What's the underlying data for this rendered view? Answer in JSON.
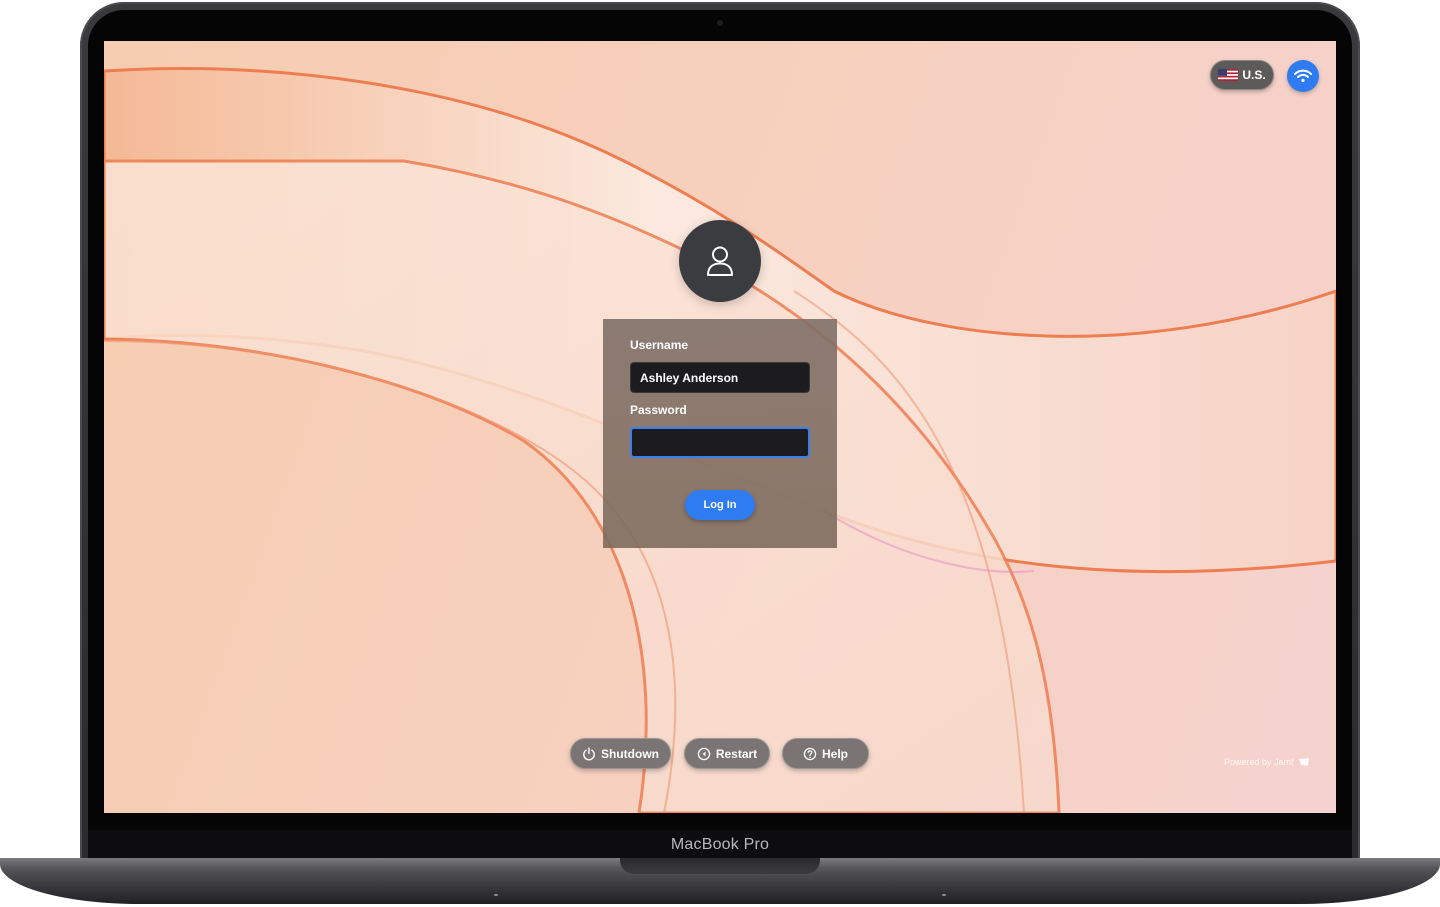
{
  "device": {
    "label": "MacBook Pro"
  },
  "topbar": {
    "language_label": "U.S.",
    "language_icon": "us-flag-icon",
    "wifi_icon": "wifi-icon"
  },
  "login": {
    "avatar_icon": "user-icon",
    "username_label": "Username",
    "username_value": "Ashley Anderson",
    "password_label": "Password",
    "password_value": "",
    "login_button": "Log In"
  },
  "actions": [
    {
      "label": "Shutdown",
      "icon": "power-icon"
    },
    {
      "label": "Restart",
      "icon": "restart-icon"
    },
    {
      "label": "Help",
      "icon": "help-icon"
    }
  ],
  "footer": {
    "powered_by": "Powered by Jamf",
    "logo_icon": "jamf-logo-icon"
  },
  "colors": {
    "accent": "#2f7bf2",
    "panel": "#7d6b62",
    "field_bg": "#1c1c1e",
    "wallpaper_light": "#fbe6dc",
    "wallpaper_stroke": "#ee7e52"
  }
}
